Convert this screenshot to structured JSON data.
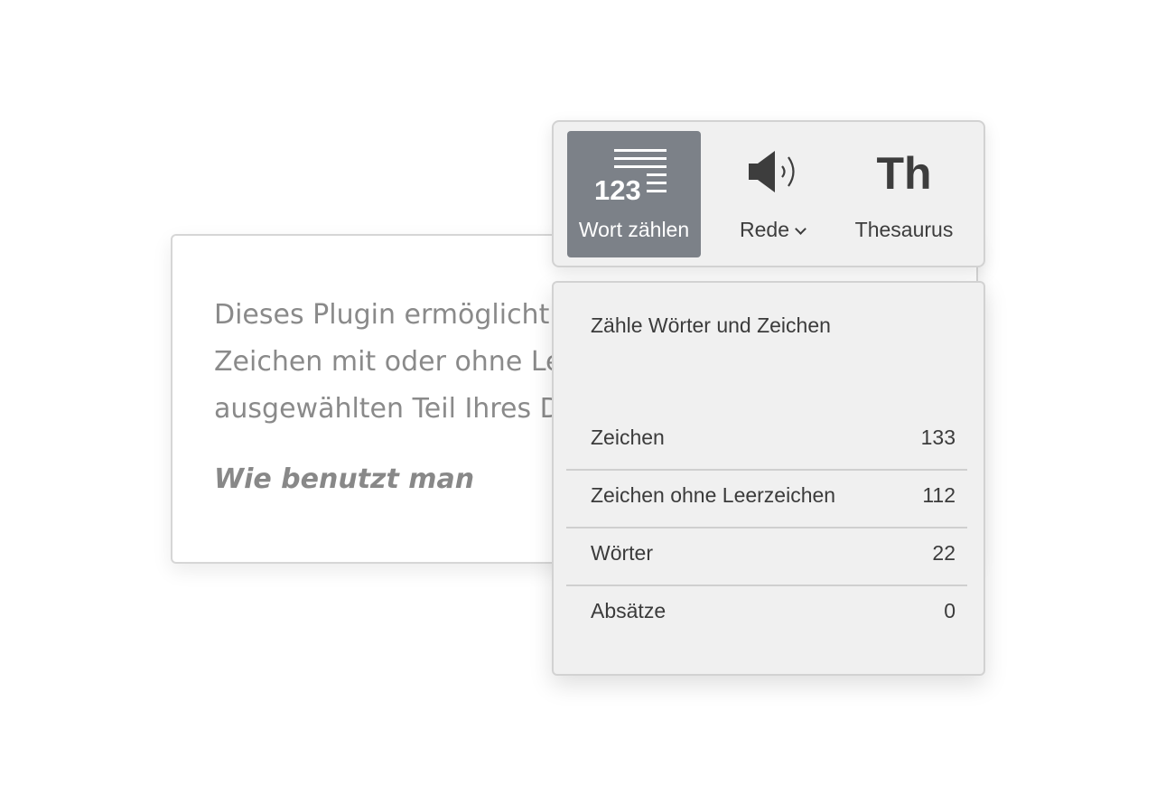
{
  "document": {
    "lines": [
      "Dieses Plugin ermöglicht",
      "Zeichen mit oder ohne Le",
      "ausgewählten Teil Ihres D"
    ],
    "heading": "Wie benutzt man"
  },
  "toolbar": {
    "word_count": {
      "label": "Wort zählen",
      "icon": "word-count-icon",
      "icon_text": "123",
      "active": true
    },
    "speech": {
      "label": "Rede",
      "icon": "speaker-icon"
    },
    "thesaurus": {
      "label": "Thesaurus",
      "icon": "thesaurus-icon",
      "icon_text": "Th"
    }
  },
  "panel": {
    "title": "Zähle Wörter und Zeichen",
    "rows": [
      {
        "label": "Zeichen",
        "value": "133"
      },
      {
        "label": "Zeichen ohne Leerzeichen",
        "value": "112"
      },
      {
        "label": "Wörter",
        "value": "22"
      },
      {
        "label": "Absätze",
        "value": "0"
      }
    ]
  },
  "colors": {
    "active_button": "#7c8188",
    "panel_bg": "#f0f0f0",
    "text": "#3b3b3b",
    "doc_text": "#8a8a8a"
  }
}
